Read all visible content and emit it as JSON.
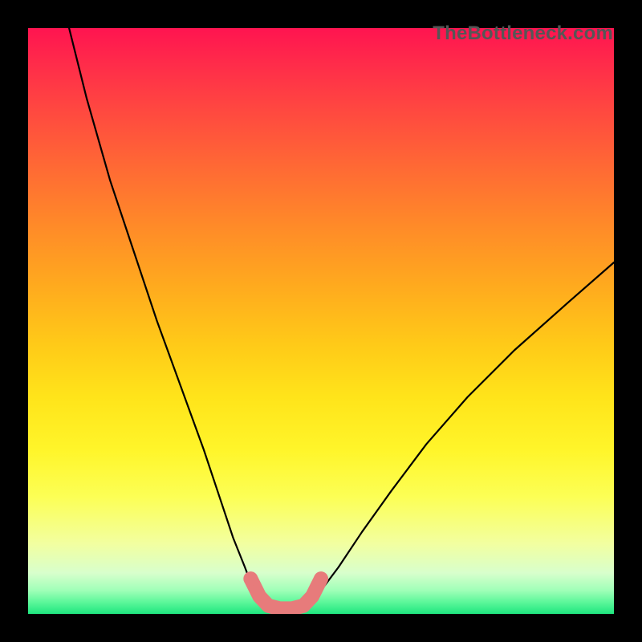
{
  "watermark": "TheBottleneck.com",
  "chart_data": {
    "type": "line",
    "title": "",
    "xlabel": "",
    "ylabel": "",
    "xlim": [
      0,
      100
    ],
    "ylim": [
      0,
      100
    ],
    "series": [
      {
        "name": "black-curve",
        "color": "#000000",
        "x": [
          7,
          10,
          14,
          18,
          22,
          26,
          30,
          33,
          35,
          37,
          38.5,
          40,
          42,
          44,
          46,
          48,
          50,
          53,
          57,
          62,
          68,
          75,
          83,
          92,
          100
        ],
        "y": [
          100,
          88,
          74,
          62,
          50,
          39,
          28,
          19,
          13,
          8,
          4,
          1.5,
          0.6,
          0.4,
          0.6,
          1.5,
          4,
          8,
          14,
          21,
          29,
          37,
          45,
          53,
          60
        ]
      },
      {
        "name": "pink-band",
        "color": "#e77b7b",
        "x": [
          38,
          39.5,
          41,
          43,
          45,
          47,
          48.5,
          50
        ],
        "y": [
          6,
          3,
          1.4,
          0.9,
          0.9,
          1.4,
          3,
          6
        ]
      }
    ],
    "annotations": [],
    "background": {
      "type": "vertical-gradient",
      "stops": [
        {
          "pos": 0.0,
          "color": "#ff1450"
        },
        {
          "pos": 0.5,
          "color": "#ffca18"
        },
        {
          "pos": 0.85,
          "color": "#f2ffa0"
        },
        {
          "pos": 1.0,
          "color": "#1fe67f"
        }
      ]
    }
  }
}
